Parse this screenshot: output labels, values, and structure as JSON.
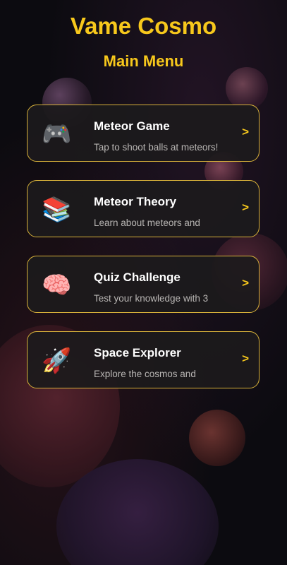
{
  "app": {
    "title": "Vame Cosmo",
    "subtitle": "Main Menu"
  },
  "colors": {
    "accent": "#f7c81c",
    "card_border": "#d8b23a",
    "card_bg": "#1c1a1c",
    "title_text": "#ffffff",
    "desc_text": "#b9b6b4"
  },
  "menu": {
    "items": [
      {
        "icon": "game-controller-icon",
        "icon_glyph": "🎮",
        "title": "Meteor Game",
        "description": "Tap to shoot balls at meteors!",
        "chevron": ">"
      },
      {
        "icon": "books-icon",
        "icon_glyph": "📚",
        "title": "Meteor Theory",
        "description": "Learn about meteors and",
        "chevron": ">"
      },
      {
        "icon": "brain-icon",
        "icon_glyph": "🧠",
        "title": "Quiz Challenge",
        "description": "Test your knowledge with 3",
        "chevron": ">"
      },
      {
        "icon": "rocket-icon",
        "icon_glyph": "🚀",
        "title": "Space Explorer",
        "description": "Explore the cosmos and",
        "chevron": ">"
      }
    ]
  }
}
